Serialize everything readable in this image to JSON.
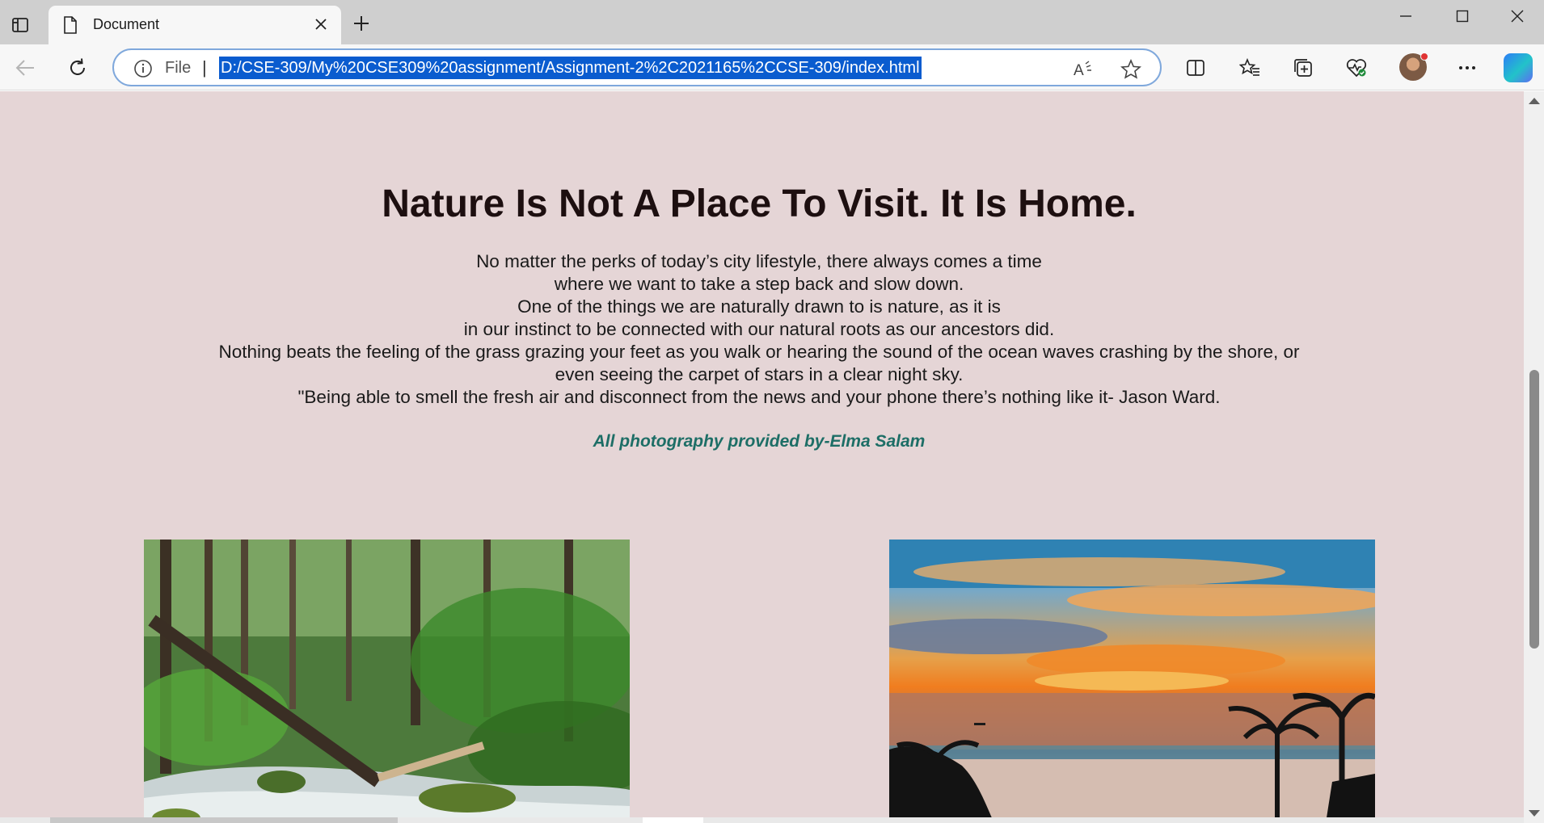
{
  "browser": {
    "tab": {
      "title": "Document"
    },
    "addressbar": {
      "scheme_label": "File",
      "separator": "|",
      "url": "D:/CSE-309/My%20CSE309%20assignment/Assignment-2%2C2021165%2CCSE-309/index.html"
    },
    "icons": {
      "tab_actions": "tab-actions-icon",
      "new_tab": "plus-icon",
      "back": "arrow-left-icon",
      "refresh": "refresh-icon",
      "info": "info-icon",
      "read_aloud": "read-aloud-icon",
      "favorite": "star-icon",
      "split_screen": "split-screen-icon",
      "favorites": "favorites-icon",
      "collections": "collections-icon",
      "browser_essentials": "heart-pulse-icon",
      "profile": "avatar",
      "more": "more-icon",
      "copilot": "copilot-icon"
    }
  },
  "page": {
    "background": "#e5d5d6",
    "headline": "Nature Is Not A Place To Visit. It Is Home.",
    "paragraph_lines": [
      "No matter the perks of today’s city lifestyle, there always comes a time",
      "where we want to take a step back and slow down.",
      "One of the things we are naturally drawn to is nature, as it is",
      "in our instinct to be connected with our natural roots as our ancestors did.",
      "Nothing beats the feeling of the grass grazing your feet as you walk or hearing the sound of the ocean waves crashing by the shore, or",
      "even seeing the carpet of stars in a clear night sky.",
      "\"Being able to smell the fresh air and disconnect from the news and your phone there’s nothing like it- Jason Ward."
    ],
    "credit": "All photography provided by-Elma Salam",
    "credit_color": "#1d6e66"
  }
}
